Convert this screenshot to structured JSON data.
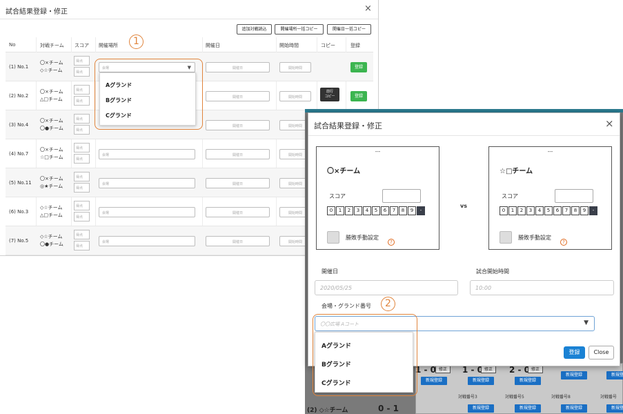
{
  "left_modal": {
    "title": "試合結果登録・修正",
    "close": "×",
    "toolbar": {
      "add_match": "追加対戦読込",
      "place_copy": "開催場所一括コピー",
      "date_copy": "開催日一括コピー"
    },
    "columns": [
      "No",
      "対戦チーム",
      "スコア",
      "開催場所",
      "開催日",
      "開始時間",
      "コピー",
      "登録"
    ],
    "placeholders": {
      "score": "得点",
      "place": "会場",
      "date": "開催日",
      "time": "開始時間"
    },
    "copy_button": "前行\nコピー",
    "register_button": "登録",
    "rows": [
      {
        "no": "(1) No.1",
        "team_a": "〇×チーム",
        "team_b": "◇☆チーム"
      },
      {
        "no": "(2) No.2",
        "team_a": "〇×チーム",
        "team_b": "△□チーム"
      },
      {
        "no": "(3) No.4",
        "team_a": "〇×チーム",
        "team_b": "〇●チーム"
      },
      {
        "no": "(4) No.7",
        "team_a": "〇×チーム",
        "team_b": "☆□チーム"
      },
      {
        "no": "(5) No.11",
        "team_a": "〇×チーム",
        "team_b": "◎★チーム"
      },
      {
        "no": "(6) No.3",
        "team_a": "◇☆チーム",
        "team_b": "△□チーム"
      },
      {
        "no": "(7) No.5",
        "team_a": "◇☆チーム",
        "team_b": "〇●チーム"
      }
    ],
    "dropdown": [
      "Aグランド",
      "Bグランド",
      "Cグランド"
    ],
    "callout": "1"
  },
  "front_modal": {
    "title": "試合結果登録・修正",
    "close": "×",
    "team_left": {
      "dash": "---",
      "name": "〇×チーム"
    },
    "team_right": {
      "dash": "---",
      "name": "☆□チーム"
    },
    "score_label": "スコア",
    "digits": [
      "0",
      "1",
      "2",
      "3",
      "4",
      "5",
      "6",
      "7",
      "8",
      "9",
      "-"
    ],
    "manual_label": "勝敗手動設定",
    "help_icon": "?",
    "vs": "vs",
    "date_label": "開催日",
    "date_placeholder": "2020/05/25",
    "time_label": "試合開始時間",
    "time_placeholder": "10:00",
    "venue_label": "会場・グランド番号",
    "venue_placeholder": "〇〇広場 Aコート",
    "venue_caret": "▼",
    "dropdown": [
      "Aグランド",
      "Bグランド",
      "Cグランド"
    ],
    "register_button": "登録",
    "close_button": "Close",
    "callout": "2"
  },
  "background": {
    "scores": [
      "1 - 0",
      "1 - 0",
      "2 - 0",
      "0 - 1"
    ],
    "fix_label": "修正",
    "new_label": "新規登録",
    "match_labels": [
      "対戦番号3",
      "対戦番号5",
      "対戦番号8",
      "対戦番号"
    ],
    "row_team": "(2) ◇☆チーム"
  },
  "colors": {
    "register_green": "#3cb550",
    "primary_blue": "#1a82d4",
    "callout_orange": "#e0843c"
  }
}
